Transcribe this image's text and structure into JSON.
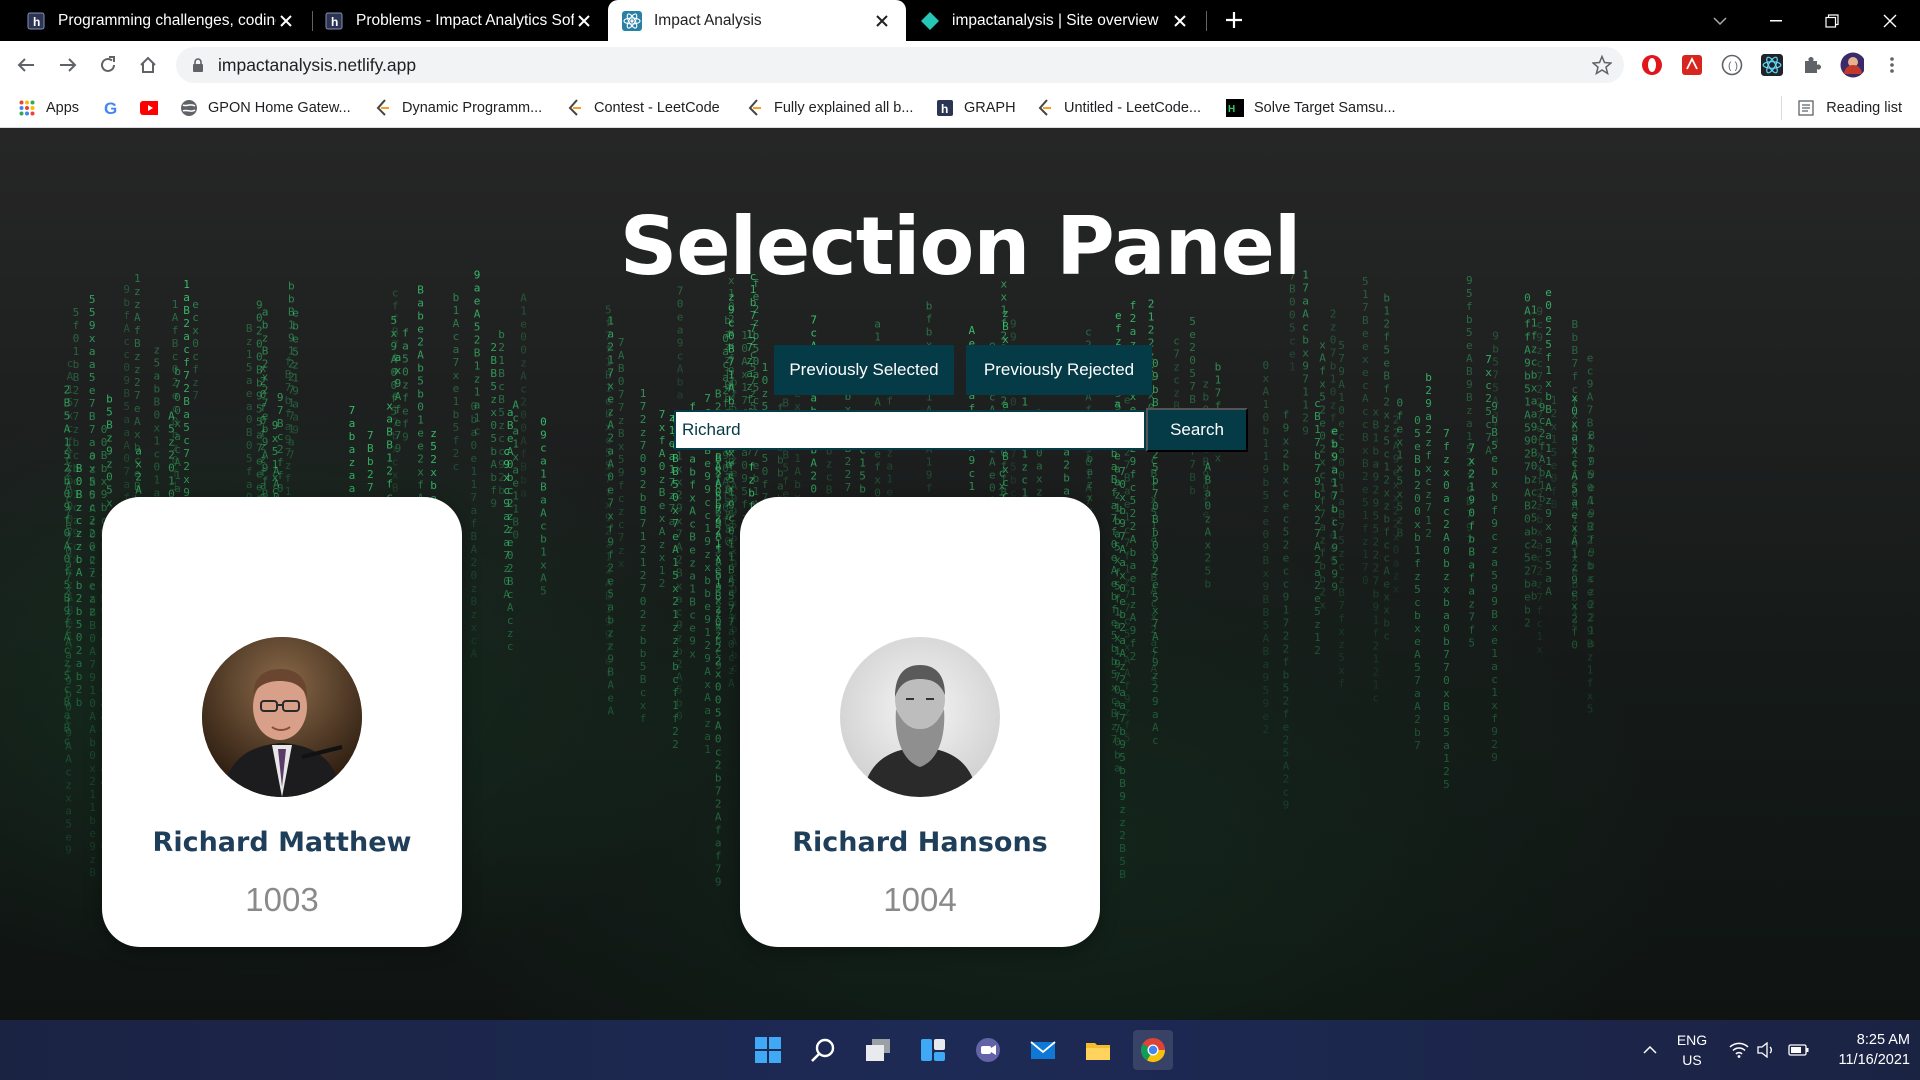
{
  "browser": {
    "tabs": [
      {
        "title": "Programming challenges, coding",
        "icon": "hackerearth-icon"
      },
      {
        "title": "Problems - Impact Analytics Softw",
        "icon": "hackerearth-icon"
      },
      {
        "title": "Impact Analysis",
        "icon": "react-icon",
        "active": true
      },
      {
        "title": "impactanalysis | Site overview",
        "icon": "netlify-icon"
      }
    ],
    "url": "impactanalysis.netlify.app",
    "bookmarks": [
      {
        "label": "Apps",
        "icon": "apps-grid-icon"
      },
      {
        "label": "",
        "icon": "google-icon"
      },
      {
        "label": "",
        "icon": "youtube-icon"
      },
      {
        "label": "GPON Home Gatew...",
        "icon": "globe-icon"
      },
      {
        "label": "Dynamic Programm...",
        "icon": "leetcode-icon"
      },
      {
        "label": "Contest - LeetCode",
        "icon": "leetcode-icon"
      },
      {
        "label": "Fully explained all b...",
        "icon": "leetcode-icon"
      },
      {
        "label": "GRAPH",
        "icon": "hackerearth-icon"
      },
      {
        "label": "Untitled - LeetCode...",
        "icon": "leetcode-icon"
      },
      {
        "label": "Solve Target Samsu...",
        "icon": "hackerrank-icon"
      }
    ],
    "reading_list": "Reading list"
  },
  "page": {
    "title": "Selection Panel",
    "previously_selected": "Previously Selected",
    "previously_rejected": "Previously Rejected",
    "search": {
      "value": "Richard",
      "button": "Search"
    },
    "cards": [
      {
        "name": "Richard Matthew",
        "id": "1003"
      },
      {
        "name": "Richard Hansons",
        "id": "1004"
      }
    ]
  },
  "taskbar": {
    "lang_line1": "ENG",
    "lang_line2": "US",
    "time": "8:25 AM",
    "date": "11/16/2021"
  },
  "colors": {
    "accent": "#053a47",
    "card_name": "#1f3e5a",
    "card_id": "#8a8a8a"
  }
}
